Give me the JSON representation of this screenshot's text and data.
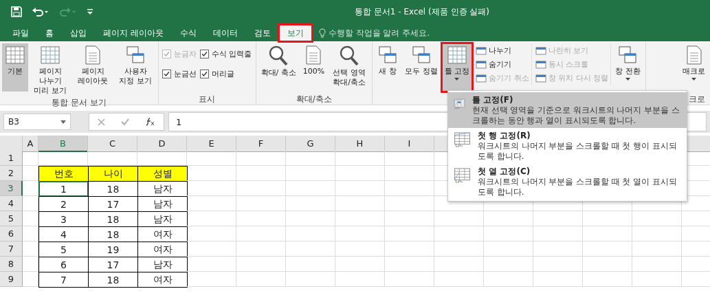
{
  "title_bar": {
    "title": "통합 문서1 - Excel (제품 인증 실패)"
  },
  "tabs": [
    {
      "label": "파일",
      "selected": false,
      "highlighted": false
    },
    {
      "label": "홈",
      "selected": false,
      "highlighted": false
    },
    {
      "label": "삽입",
      "selected": false,
      "highlighted": false
    },
    {
      "label": "페이지 레이아웃",
      "selected": false,
      "highlighted": false
    },
    {
      "label": "수식",
      "selected": false,
      "highlighted": false
    },
    {
      "label": "데이터",
      "selected": false,
      "highlighted": false
    },
    {
      "label": "검토",
      "selected": false,
      "highlighted": false
    },
    {
      "label": "보기",
      "selected": true,
      "highlighted": true
    }
  ],
  "tell_me": {
    "placeholder": "수행할 작업을 알려 주세요."
  },
  "ribbon": {
    "groups": [
      {
        "label": "통합 문서 보기",
        "items": [
          {
            "kind": "large",
            "label": "기본",
            "selected": true,
            "highlighted": false,
            "disabled": false
          },
          {
            "kind": "large",
            "label": "페이지 나누기 미리 보기",
            "selected": false,
            "highlighted": false,
            "disabled": false
          },
          {
            "kind": "large",
            "label": "페이지 레이아웃",
            "selected": false,
            "highlighted": false,
            "disabled": false
          },
          {
            "kind": "large",
            "label": "사용자 지정 보기",
            "selected": false,
            "highlighted": false,
            "disabled": false
          }
        ]
      },
      {
        "label": "표시",
        "items": [
          {
            "kind": "check",
            "label": "눈금자",
            "checked": true,
            "disabled": true
          },
          {
            "kind": "check",
            "label": "수식 입력줄",
            "checked": true,
            "disabled": false
          },
          {
            "kind": "check",
            "label": "눈금선",
            "checked": true,
            "disabled": false
          },
          {
            "kind": "check",
            "label": "머리글",
            "checked": true,
            "disabled": false
          }
        ]
      },
      {
        "label": "확대/축소",
        "items": [
          {
            "kind": "large",
            "label": "확대/ 축소",
            "selected": false,
            "highlighted": false,
            "disabled": false
          },
          {
            "kind": "large",
            "label": "100%",
            "selected": false,
            "highlighted": false,
            "disabled": false
          },
          {
            "kind": "large",
            "label": "선택 영역 확대/축소",
            "selected": false,
            "highlighted": false,
            "disabled": false
          }
        ]
      },
      {
        "items": [
          {
            "kind": "large",
            "label": "새 창",
            "selected": false,
            "highlighted": false,
            "disabled": false
          },
          {
            "kind": "large",
            "label": "모두 정렬",
            "selected": false,
            "highlighted": false,
            "disabled": false
          },
          {
            "kind": "large",
            "label": "틀 고정",
            "selected": true,
            "highlighted": true,
            "disabled": false,
            "dropdown": true
          },
          {
            "kind": "small",
            "label": "나누기",
            "disabled": false
          },
          {
            "kind": "small",
            "label": "숨기기",
            "disabled": false
          },
          {
            "kind": "small",
            "label": "숨기기 취소",
            "disabled": true
          },
          {
            "kind": "small",
            "label": "나란히 보기",
            "disabled": true
          },
          {
            "kind": "small",
            "label": "동시 스크롤",
            "disabled": true
          },
          {
            "kind": "small",
            "label": "창 위치 다시 정렬",
            "disabled": true
          },
          {
            "kind": "large",
            "label": "창 전환",
            "selected": false,
            "highlighted": false,
            "disabled": false,
            "dropdown": true
          }
        ]
      },
      {
        "label": "크로",
        "items": [
          {
            "kind": "large",
            "label": "매크로",
            "selected": false,
            "highlighted": false,
            "disabled": false,
            "dropdown": true
          }
        ]
      }
    ]
  },
  "formula_bar": {
    "name_box": "B3",
    "value": "1"
  },
  "sheet": {
    "columns": [
      {
        "label": "A",
        "selected": false
      },
      {
        "label": "B",
        "selected": true
      },
      {
        "label": "C",
        "selected": false
      },
      {
        "label": "D",
        "selected": false
      },
      {
        "label": "E",
        "selected": false
      },
      {
        "label": "F",
        "selected": false
      },
      {
        "label": "G",
        "selected": false
      },
      {
        "label": "H",
        "selected": false
      },
      {
        "label": "I",
        "selected": false
      }
    ],
    "rows": [
      {
        "label": "1",
        "selected": false,
        "kind": "empty"
      },
      {
        "label": "2",
        "selected": false,
        "kind": "header",
        "cells": [
          {
            "text": "번호",
            "selected": false
          },
          {
            "text": "나이",
            "selected": false
          },
          {
            "text": "성별",
            "selected": false
          }
        ]
      },
      {
        "label": "3",
        "selected": true,
        "kind": "data",
        "cells": [
          {
            "text": "1",
            "selected": true
          },
          {
            "text": "18",
            "selected": false
          },
          {
            "text": "남자",
            "selected": false
          }
        ]
      },
      {
        "label": "4",
        "selected": false,
        "kind": "data",
        "cells": [
          {
            "text": "2",
            "selected": false
          },
          {
            "text": "17",
            "selected": false
          },
          {
            "text": "남자",
            "selected": false
          }
        ]
      },
      {
        "label": "5",
        "selected": false,
        "kind": "data",
        "cells": [
          {
            "text": "3",
            "selected": false
          },
          {
            "text": "18",
            "selected": false
          },
          {
            "text": "남자",
            "selected": false
          }
        ]
      },
      {
        "label": "6",
        "selected": false,
        "kind": "data",
        "cells": [
          {
            "text": "4",
            "selected": false
          },
          {
            "text": "18",
            "selected": false
          },
          {
            "text": "여자",
            "selected": false
          }
        ]
      },
      {
        "label": "7",
        "selected": false,
        "kind": "data",
        "cells": [
          {
            "text": "5",
            "selected": false
          },
          {
            "text": "19",
            "selected": false
          },
          {
            "text": "여자",
            "selected": false
          }
        ]
      },
      {
        "label": "8",
        "selected": false,
        "kind": "data",
        "cells": [
          {
            "text": "6",
            "selected": false
          },
          {
            "text": "17",
            "selected": false
          },
          {
            "text": "남자",
            "selected": false
          }
        ]
      },
      {
        "label": "9",
        "selected": false,
        "kind": "data",
        "cells": [
          {
            "text": "7",
            "selected": false
          },
          {
            "text": "18",
            "selected": false
          },
          {
            "text": "여자",
            "selected": false
          }
        ]
      }
    ]
  },
  "dropdown": {
    "items": [
      {
        "title": "틀 고정(F)",
        "description": "현재 선택 영역을 기준으로 워크시트의 나머지 부분을 스크롤하는 동안 행과 열이 표시되도록 합니다.",
        "selected": true
      },
      {
        "title": "첫 행 고정(R)",
        "description": "워크시트의 나머지 부분을 스크롤할 때 첫 행이 표시되도록 합니다.",
        "selected": false
      },
      {
        "title": "첫 열 고정(C)",
        "description": "워크시트의 나머지 부분을 스크롤할 때 첫 열이 표시되도록 합니다.",
        "selected": false
      }
    ]
  }
}
